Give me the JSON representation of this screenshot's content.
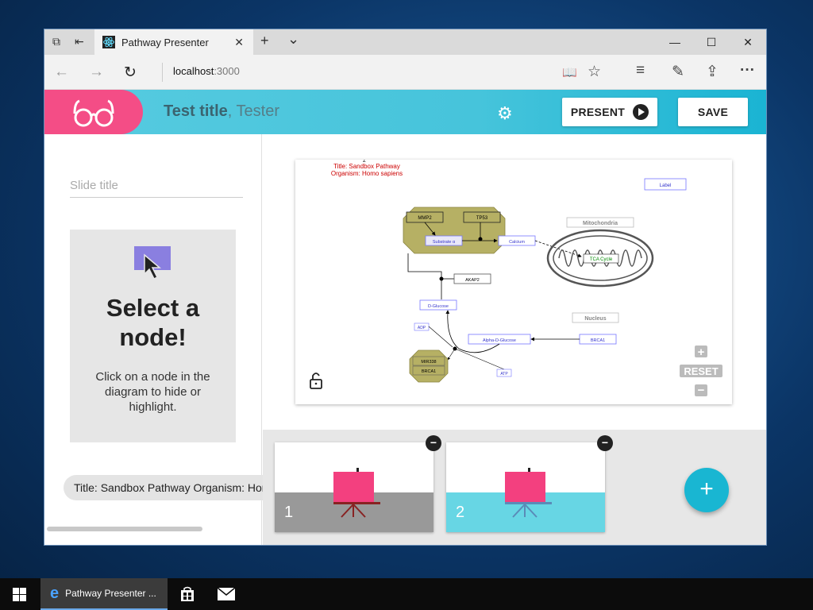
{
  "browser": {
    "tab_title": "Pathway Presenter",
    "tab_close": "✕",
    "new_tab": "+",
    "tab_list": "⌄",
    "win_min": "—",
    "win_max": "☐",
    "win_close": "✕",
    "back": "←",
    "forward": "→",
    "refresh": "↻",
    "url_host": "localhost",
    "url_port": ":3000",
    "reading": "📖",
    "favorite": "☆",
    "hub": "≡",
    "notes": "✎",
    "share": "⇪",
    "more": "···"
  },
  "header": {
    "title": "Test title",
    "author": ", Tester",
    "present_label": "PRESENT",
    "save_label": "SAVE",
    "accent": "#f44d86",
    "brand": "#46c4db"
  },
  "left": {
    "slide_title_placeholder": "Slide title",
    "card_title": "Select a node!",
    "card_desc": "Click on a node in the diagram to hide or highlight.",
    "chip_text": "Title: Sandbox Pathway Organism: Homo sapiens"
  },
  "diagram": {
    "title_line1": "Title: Sandbox Pathway",
    "title_line2": "Organism: Homo sapiens",
    "marker": "Σ",
    "label_node": "Label",
    "mitochondria": "Mitochondria",
    "tca": "TCA Cycle",
    "nucleus": "Nucleus",
    "mmp2": "MMP2",
    "tp53": "TP53",
    "substrate": "Substrate α",
    "calcium": "Calcium",
    "akap2": "AKAP2",
    "dglucose": "D-Glucose",
    "adp": "ADP",
    "alpha_glucose": "Alpha-D-Glucose",
    "brca1": "BRCA1",
    "mir": "MIR338",
    "brca1_b": "BRCA1",
    "atp": "ATP",
    "reset": "RESET",
    "zoom_in": "+",
    "zoom_out": "−"
  },
  "slides": [
    {
      "number": "1",
      "band_color": "#999999"
    },
    {
      "number": "2",
      "band_color": "#67d6e4"
    }
  ],
  "fab": "+",
  "taskbar": {
    "app_label": "Pathway Presenter ..."
  }
}
